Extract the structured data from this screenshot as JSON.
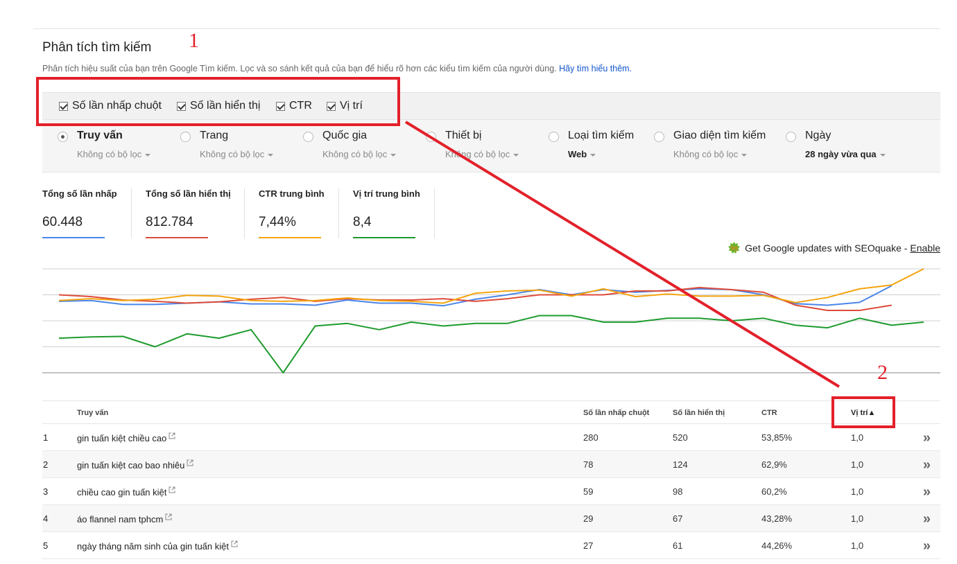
{
  "title": "Phân tích tìm kiếm",
  "subtitle": "Phân tích hiệu suất của bạn trên Google Tìm kiếm. Lọc và so sánh kết quả của bạn để hiểu rõ hơn các kiểu tìm kiếm của người dùng.",
  "learn_more": "Hãy tìm hiểu thêm.",
  "annotations": {
    "one": "1",
    "two": "2"
  },
  "metrics": [
    {
      "label": "Số lần nhấp chuột",
      "checked": true
    },
    {
      "label": "Số lần hiển thị",
      "checked": true
    },
    {
      "label": "CTR",
      "checked": true
    },
    {
      "label": "Vị trí",
      "checked": true
    }
  ],
  "dimensions": [
    {
      "label": "Truy vấn",
      "sub": "Không có bộ lọc",
      "selected": true
    },
    {
      "label": "Trang",
      "sub": "Không có bộ lọc",
      "selected": false
    },
    {
      "label": "Quốc gia",
      "sub": "Không có bộ lọc",
      "selected": false
    },
    {
      "label": "Thiết bị",
      "sub": "Không có bộ lọc",
      "selected": false
    },
    {
      "label": "Loại tìm kiếm",
      "sub": "Web",
      "selected": false
    },
    {
      "label": "Giao diện tìm kiếm",
      "sub": "Không có bộ lọc",
      "selected": false
    },
    {
      "label": "Ngày",
      "sub": "28 ngày vừa qua",
      "selected": false
    }
  ],
  "stats": [
    {
      "label": "Tổng số lần nhấp",
      "value": "60.448",
      "color": "#4a86e8"
    },
    {
      "label": "Tổng số lần hiển thị",
      "value": "812.784",
      "color": "#dd4b39"
    },
    {
      "label": "CTR trung bình",
      "value": "7,44%",
      "color": "#f4a40e"
    },
    {
      "label": "Vị trí trung bình",
      "value": "8,4",
      "color": "#1e9b2d"
    }
  ],
  "seoquake": {
    "text": "Get Google updates with SEOquake -",
    "link": "Enable"
  },
  "chart_data": {
    "type": "line",
    "x": [
      1,
      2,
      3,
      4,
      5,
      6,
      7,
      8,
      9,
      10,
      11,
      12,
      13,
      14,
      15,
      16,
      17,
      18,
      19,
      20,
      21,
      22,
      23,
      24,
      25,
      26,
      27,
      28
    ],
    "ylim": [
      0,
      4
    ],
    "grid": true,
    "series": [
      {
        "name": "Số lần nhấp chuột",
        "color": "#4a86e8",
        "values": [
          2.75,
          2.78,
          2.63,
          2.63,
          2.68,
          2.73,
          2.65,
          2.65,
          2.6,
          2.8,
          2.68,
          2.68,
          2.58,
          2.83,
          3.0,
          3.2,
          3.0,
          3.2,
          3.1,
          3.17,
          3.23,
          3.2,
          3.0,
          2.66,
          2.6,
          2.71,
          3.35
        ]
      },
      {
        "name": "Số lần hiển thị",
        "color": "#dd4b39",
        "values": [
          3.0,
          2.93,
          2.8,
          2.75,
          2.68,
          2.73,
          2.83,
          2.9,
          2.75,
          2.85,
          2.8,
          2.8,
          2.85,
          2.75,
          2.85,
          3.0,
          3.0,
          3.0,
          3.15,
          3.15,
          3.28,
          3.2,
          3.1,
          2.6,
          2.4,
          2.4,
          2.6
        ]
      },
      {
        "name": "CTR",
        "color": "#f4a40e",
        "values": [
          2.78,
          2.85,
          2.78,
          2.83,
          2.98,
          2.95,
          2.78,
          2.75,
          2.78,
          2.88,
          2.78,
          2.75,
          2.68,
          3.06,
          3.15,
          3.18,
          2.95,
          3.23,
          2.93,
          3.03,
          2.95,
          2.95,
          2.98,
          2.7,
          2.9,
          3.23,
          3.38,
          4.0
        ]
      },
      {
        "name": "Vị trí",
        "color": "#1e9b2d",
        "values": [
          1.33,
          1.38,
          1.4,
          1.0,
          1.5,
          1.33,
          1.66,
          0.0,
          1.8,
          1.9,
          1.66,
          1.95,
          1.8,
          1.9,
          1.9,
          2.2,
          2.2,
          1.95,
          1.95,
          2.1,
          2.1,
          2.0,
          2.1,
          1.83,
          1.73,
          2.1,
          1.83,
          1.95
        ]
      }
    ]
  },
  "table": {
    "headers": {
      "query": "Truy vấn",
      "clicks": "Số lần nhấp chuột",
      "impressions": "Số lần hiển thị",
      "ctr": "CTR",
      "position": "Vị trí▲"
    },
    "rows": [
      {
        "idx": "1",
        "query": "gin tuấn kiệt chiều cao",
        "clicks": "280",
        "impressions": "520",
        "ctr": "53,85%",
        "position": "1,0"
      },
      {
        "idx": "2",
        "query": "gin tuấn kiệt cao bao nhiêu",
        "clicks": "78",
        "impressions": "124",
        "ctr": "62,9%",
        "position": "1,0"
      },
      {
        "idx": "3",
        "query": "chiều cao gin tuấn kiệt",
        "clicks": "59",
        "impressions": "98",
        "ctr": "60,2%",
        "position": "1,0"
      },
      {
        "idx": "4",
        "query": "áo flannel nam tphcm",
        "clicks": "29",
        "impressions": "67",
        "ctr": "43,28%",
        "position": "1,0"
      },
      {
        "idx": "5",
        "query": "ngày tháng năm sinh của gin tuấn kiệt",
        "clicks": "27",
        "impressions": "61",
        "ctr": "44,26%",
        "position": "1,0"
      }
    ]
  },
  "icons": {
    "external": "external-link-icon",
    "row_action": "chevron-double-right-icon",
    "seoquake": "seoquake-logo-icon"
  },
  "accent": "#e3202a"
}
